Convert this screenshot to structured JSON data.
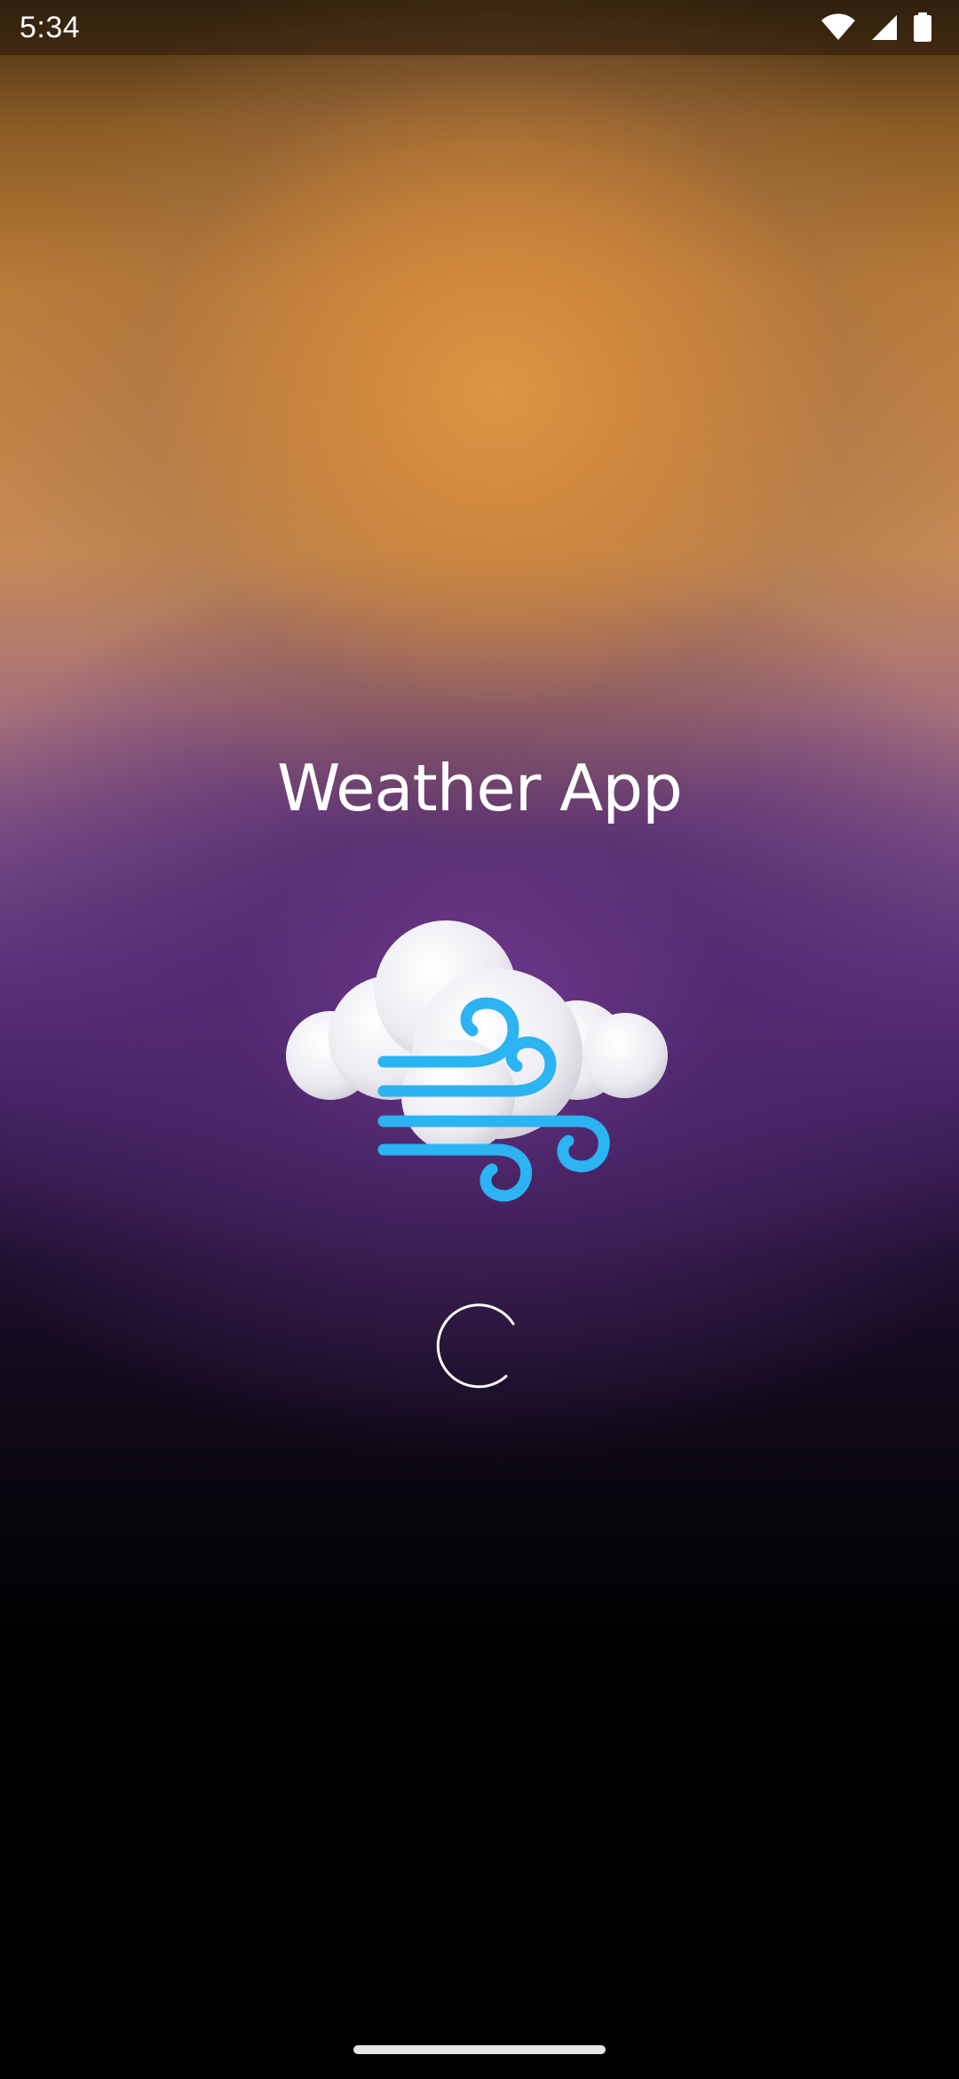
{
  "status_bar": {
    "time": "5:34",
    "icons": [
      "wifi-icon",
      "signal-icon",
      "battery-icon"
    ]
  },
  "app": {
    "title": "Weather App",
    "illustration": "windy-cloud-icon",
    "loading_indicator": "loading-spinner"
  },
  "colors": {
    "top_glow": "#D28A42",
    "middle_purple": "#5E3380",
    "bottom": "#000000",
    "wind_blue": "#2BB3F2",
    "cloud_white": "#FFFFFF"
  }
}
